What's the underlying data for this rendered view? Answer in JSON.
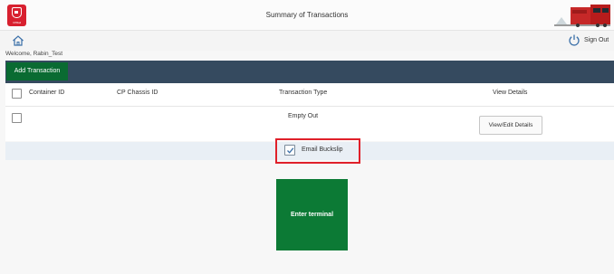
{
  "header": {
    "title": "Summary of Transactions",
    "logo_text": "CPRail"
  },
  "nav": {
    "sign_out_label": "Sign Out"
  },
  "welcome_text": "Welcome, Rabin_Test",
  "toolbar": {
    "add_transaction_label": "Add Transaction"
  },
  "table": {
    "columns": [
      "Container ID",
      "CP Chassis ID",
      "Transaction Type",
      "View Details"
    ],
    "rows": [
      {
        "container_id": "",
        "chassis_id": "",
        "transaction_type": "Empty Out",
        "view_button_label": "View/Edit Details",
        "selected": false
      }
    ]
  },
  "email_buckslip": {
    "label": "Email Buckslip",
    "checked": true
  },
  "enter_terminal_label": "Enter terminal",
  "colors": {
    "brand_red": "#d8202f",
    "toolbar_bg": "#354a5f",
    "primary_green": "#0c7a35",
    "highlight_red": "#e0202a"
  }
}
